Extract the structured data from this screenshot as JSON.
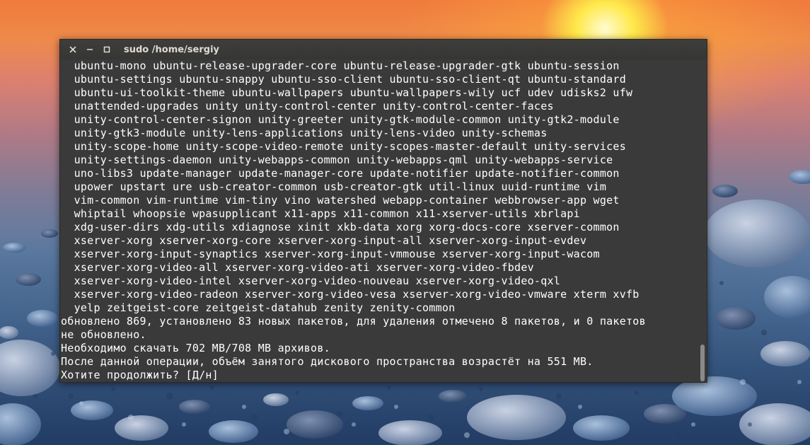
{
  "window": {
    "title": "sudo /home/sergiy",
    "controls": [
      "close-icon",
      "minimize-icon",
      "maximize-icon"
    ]
  },
  "terminal": {
    "lines": [
      "  ubuntu-mono ubuntu-release-upgrader-core ubuntu-release-upgrader-gtk ubuntu-session",
      "  ubuntu-settings ubuntu-snappy ubuntu-sso-client ubuntu-sso-client-qt ubuntu-standard",
      "  ubuntu-ui-toolkit-theme ubuntu-wallpapers ubuntu-wallpapers-wily ucf udev udisks2 ufw",
      "  unattended-upgrades unity unity-control-center unity-control-center-faces",
      "  unity-control-center-signon unity-greeter unity-gtk-module-common unity-gtk2-module",
      "  unity-gtk3-module unity-lens-applications unity-lens-video unity-schemas",
      "  unity-scope-home unity-scope-video-remote unity-scopes-master-default unity-services",
      "  unity-settings-daemon unity-webapps-common unity-webapps-qml unity-webapps-service",
      "  uno-libs3 update-manager update-manager-core update-notifier update-notifier-common",
      "  upower upstart ure usb-creator-common usb-creator-gtk util-linux uuid-runtime vim",
      "  vim-common vim-runtime vim-tiny vino watershed webapp-container webbrowser-app wget",
      "  whiptail whoopsie wpasupplicant x11-apps x11-common x11-xserver-utils xbrlapi",
      "  xdg-user-dirs xdg-utils xdiagnose xinit xkb-data xorg xorg-docs-core xserver-common",
      "  xserver-xorg xserver-xorg-core xserver-xorg-input-all xserver-xorg-input-evdev",
      "  xserver-xorg-input-synaptics xserver-xorg-input-vmmouse xserver-xorg-input-wacom",
      "  xserver-xorg-video-all xserver-xorg-video-ati xserver-xorg-video-fbdev",
      "  xserver-xorg-video-intel xserver-xorg-video-nouveau xserver-xorg-video-qxl",
      "  xserver-xorg-video-radeon xserver-xorg-video-vesa xserver-xorg-video-vmware xterm xvfb",
      "  yelp zeitgeist-core zeitgeist-datahub zenity zenity-common",
      "обновлено 869, установлено 83 новых пакетов, для удаления отмечено 8 пакетов, и 0 пакетов",
      "не обновлено.",
      "Необходимо скачать 702 MB/708 MB архивов.",
      "После данной операции, объём занятого дискового пространства возрастёт на 551 MB.",
      "Хотите продолжить? [Д/н]"
    ]
  },
  "colors": {
    "terminal_bg": "#3a3a3a",
    "terminal_fg": "#ffffff",
    "titlebar_fg": "#dfdbd2"
  }
}
